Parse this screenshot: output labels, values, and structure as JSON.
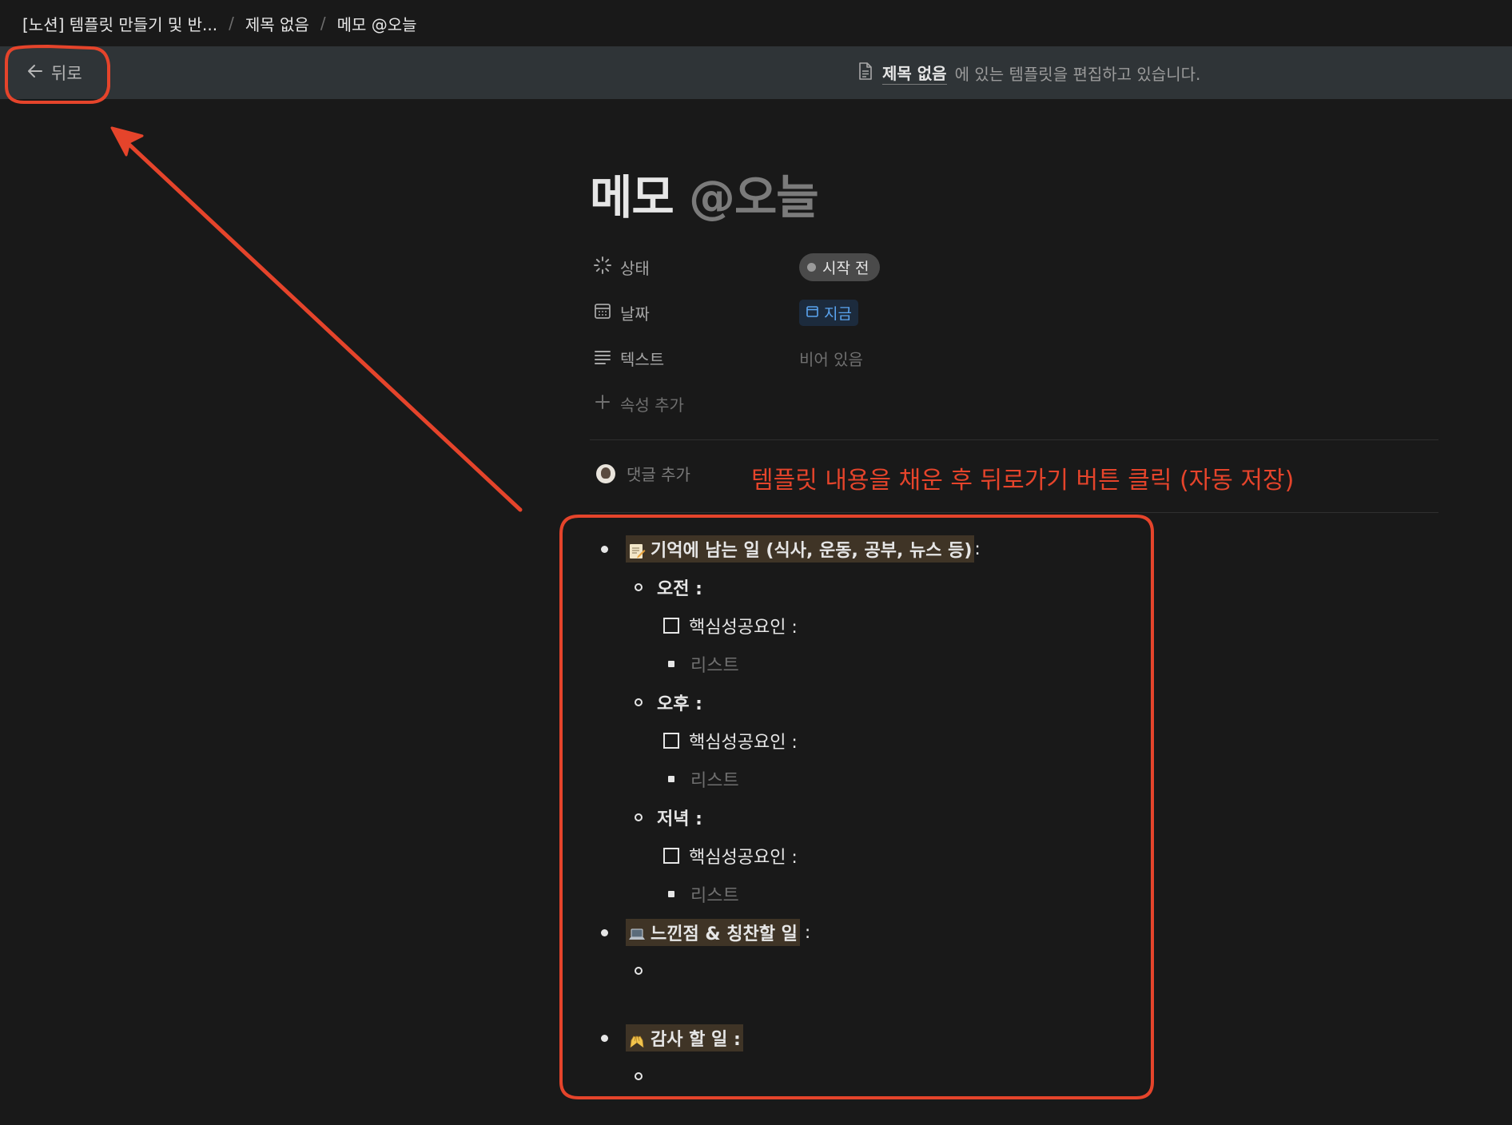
{
  "breadcrumb": [
    {
      "label": "[노션] 템플릿 만들기 및 반..."
    },
    {
      "label": "제목 없음"
    },
    {
      "label": "메모 @오늘"
    }
  ],
  "breadcrumb_sep": "/",
  "banner": {
    "back_label": "뒤로",
    "page_link": "제목 없음",
    "message": "에 있는 템플릿을 편집하고 있습니다."
  },
  "page": {
    "title_main": "메모",
    "title_mention": "@오늘"
  },
  "properties": [
    {
      "name": "상태",
      "icon": "status-icon"
    },
    {
      "name": "날짜",
      "icon": "calendar-icon"
    },
    {
      "name": "텍스트",
      "icon": "text-lines-icon"
    }
  ],
  "values": {
    "status": "시작 전",
    "date": "지금",
    "text": "비어 있음"
  },
  "add_property": "속성 추가",
  "comment_placeholder": "댓글 추가",
  "annotation": {
    "text": "템플릿 내용을 채운 후 뒤로가기 버튼 클릭 (자동 저장)",
    "color": "#e5442b"
  },
  "blocks": {
    "memory": "기억에 남는 일 (식사, 운동, 공부, 뉴스  등)",
    "memory_suffix": ":",
    "morning": "오전 :",
    "afternoon": "오후 :",
    "evening": "저녁 :",
    "todo": "핵심성공요인 :",
    "list": "리스트",
    "feelings": "느낀점 & 칭찬할 일",
    "feelings_suffix": ":",
    "thanks": "감사 할 일 :"
  },
  "colors": {
    "background": "#191919",
    "banner": "#2f3437",
    "highlight": "#3f3426",
    "date_chip_text": "#5aa4f0"
  }
}
